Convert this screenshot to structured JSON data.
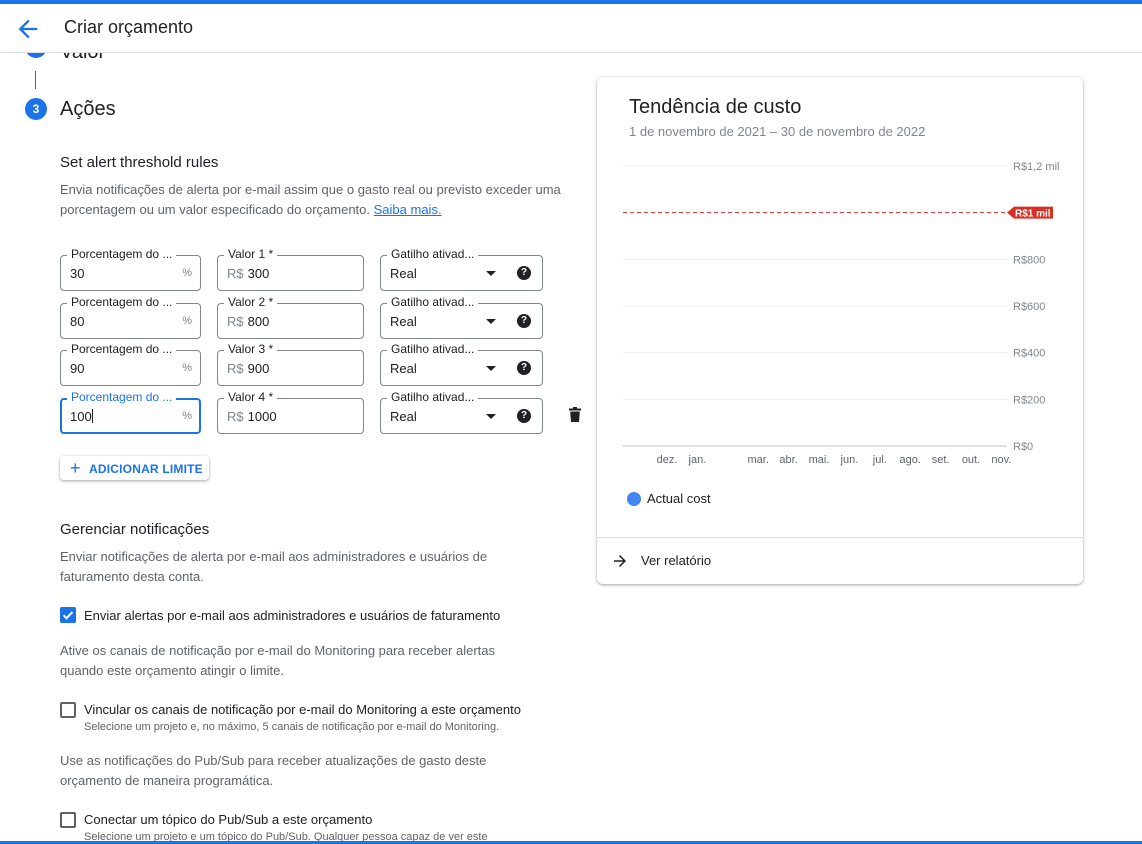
{
  "header": {
    "title": "Criar orçamento",
    "back_icon": "arrow-back-icon"
  },
  "steps": {
    "prev_title": "Valor",
    "current_number": "3",
    "current_title": "Ações"
  },
  "thresholds": {
    "title": "Set alert threshold rules",
    "description": "Envia notificações de alerta por e-mail assim que o gasto real ou previsto exceder uma porcentagem ou um valor especificado do orçamento.",
    "learn_more": "Saiba mais.",
    "rows": [
      {
        "percent_label": "Porcentagem do ...",
        "percent": "30",
        "pct_symbol": "%",
        "amount_label": "Valor 1 *",
        "currency": "R$",
        "amount": "300",
        "trigger_label": "Gatilho ativad...",
        "trigger": "Real"
      },
      {
        "percent_label": "Porcentagem do ...",
        "percent": "80",
        "pct_symbol": "%",
        "amount_label": "Valor 2 *",
        "currency": "R$",
        "amount": "800",
        "trigger_label": "Gatilho ativad...",
        "trigger": "Real"
      },
      {
        "percent_label": "Porcentagem do ...",
        "percent": "90",
        "pct_symbol": "%",
        "amount_label": "Valor 3 *",
        "currency": "R$",
        "amount": "900",
        "trigger_label": "Gatilho ativad...",
        "trigger": "Real"
      },
      {
        "percent_label": "Porcentagem do ...",
        "percent": "100",
        "pct_symbol": "%",
        "amount_label": "Valor 4 *",
        "currency": "R$",
        "amount": "1000",
        "trigger_label": "Gatilho ativad...",
        "trigger": "Real"
      }
    ],
    "add_button": "ADICIONAR LIMITE"
  },
  "notifications": {
    "title": "Gerenciar notificações",
    "description": "Enviar notificações de alerta por e-mail aos administradores e usuários de faturamento desta conta.",
    "email_admins": {
      "label": "Enviar alertas por e-mail aos administradores e usuários de faturamento",
      "checked": true
    },
    "monitoring_desc": "Ative os canais de notificação por e-mail do Monitoring para receber alertas quando este orçamento atingir o limite.",
    "monitoring": {
      "label": "Vincular os canais de notificação por e-mail do Monitoring a este orçamento",
      "sublabel": "Selecione um projeto e, no máximo, 5 canais de notificação por e-mail do Monitoring.",
      "checked": false
    },
    "pubsub_desc": "Use as notificações do Pub/Sub para receber atualizações de gasto deste orçamento de maneira programática.",
    "pubsub": {
      "label": "Conectar um tópico do Pub/Sub a este orçamento",
      "sublabel": "Selecione um projeto e um tópico do Pub/Sub. Qualquer pessoa capaz de ver este",
      "checked": false
    }
  },
  "cost_card": {
    "title": "Tendência de custo",
    "date_range": "1 de novembro de 2021 – 30 de novembro de 2022",
    "report_link": "Ver relatório"
  },
  "chart_data": {
    "type": "line",
    "title": "Tendência de custo",
    "x_ticks": [
      "dez.",
      "jan.",
      "mar.",
      "abr.",
      "mai.",
      "jun.",
      "jul.",
      "ago.",
      "set.",
      "out.",
      "nov."
    ],
    "y_ticks": [
      "R$0",
      "R$200",
      "R$400",
      "R$600",
      "R$800",
      "R$1,2 mil"
    ],
    "ylim": [
      0,
      1200
    ],
    "budget_line": {
      "value": 1000,
      "label": "R$1 mil",
      "color": "#d93025"
    },
    "series": [
      {
        "name": "Actual cost",
        "color": "#4285f4",
        "values": []
      }
    ],
    "grid": true,
    "legend": "bottom-left"
  },
  "colors": {
    "accent": "#1a73e8",
    "budget": "#d93025"
  }
}
